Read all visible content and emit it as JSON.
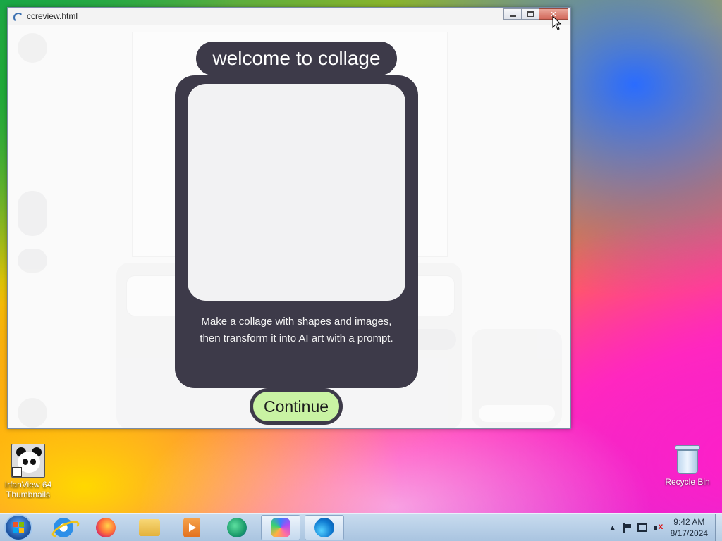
{
  "window": {
    "title": "ccreview.html"
  },
  "modal": {
    "title": "welcome to collage",
    "description": "Make a collage with shapes and images, then transform it into AI art with a prompt.",
    "continue_label": "Continue"
  },
  "desktop": {
    "icons": [
      {
        "label": "IrfanView 64 Thumbnails"
      },
      {
        "label": "Recycle Bin"
      }
    ]
  },
  "taskbar": {
    "apps": [
      {
        "name": "internet-explorer-icon"
      },
      {
        "name": "firefox-icon"
      },
      {
        "name": "file-explorer-icon"
      },
      {
        "name": "media-player-icon"
      },
      {
        "name": "edge-dev-icon"
      },
      {
        "name": "copilot-icon",
        "active": true
      },
      {
        "name": "edge-icon",
        "active": true
      }
    ],
    "clock": {
      "time": "9:42 AM",
      "date": "8/17/2024"
    }
  }
}
